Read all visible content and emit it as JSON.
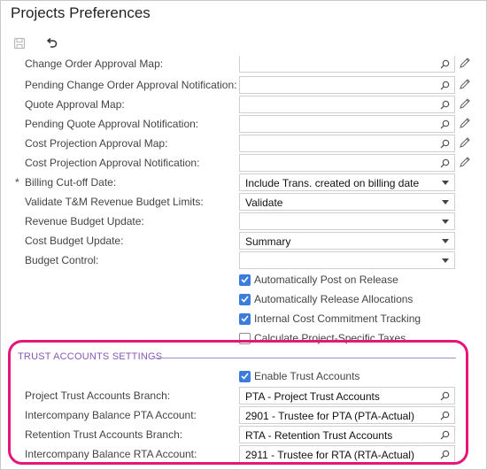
{
  "title": "Projects Preferences",
  "toolbar": {
    "save_icon": "save-icon",
    "undo_icon": "undo-icon"
  },
  "rows": {
    "change_order_map": {
      "label": "Change Order Approval Map:"
    },
    "pending_co_notification": {
      "label": "Pending Change Order Approval Notification:"
    },
    "quote_map": {
      "label": "Quote Approval Map:"
    },
    "pending_quote_notification": {
      "label": "Pending Quote Approval Notification:"
    },
    "cost_projection_map": {
      "label": "Cost Projection Approval Map:"
    },
    "cost_projection_notification": {
      "label": "Cost Projection Approval Notification:"
    },
    "billing_cutoff": {
      "required": "*",
      "label": "Billing Cut-off Date:",
      "value": "Include Trans. created on billing date"
    },
    "validate_tm": {
      "label": "Validate T&M Revenue Budget Limits:",
      "value": "Validate"
    },
    "revenue_budget_update": {
      "label": "Revenue Budget Update:",
      "value": ""
    },
    "cost_budget_update": {
      "label": "Cost Budget Update:",
      "value": "Summary"
    },
    "budget_control": {
      "label": "Budget Control:",
      "value": ""
    }
  },
  "checkboxes": {
    "auto_post": {
      "label": "Automatically Post on Release",
      "checked": true
    },
    "auto_release": {
      "label": "Automatically Release Allocations",
      "checked": true
    },
    "internal_cost": {
      "label": "Internal Cost Commitment Tracking",
      "checked": true
    },
    "calc_taxes": {
      "label": "Calculate Project-Specific Taxes",
      "checked": false
    }
  },
  "trust": {
    "header": "TRUST ACCOUNTS SETTINGS",
    "enable": {
      "label": "Enable Trust Accounts",
      "checked": true
    },
    "pta_branch": {
      "label": "Project Trust Accounts Branch:",
      "value": "PTA - Project Trust Accounts"
    },
    "ic_pta_account": {
      "label": "Intercompany Balance PTA Account:",
      "value": "2901 - Trustee for PTA (PTA-Actual)"
    },
    "rta_branch": {
      "label": "Retention Trust Accounts Branch:",
      "value": "RTA - Retention Trust Accounts"
    },
    "ic_rta_account": {
      "label": "Intercompany Balance RTA Account:",
      "value": "2911 - Trustee for RTA (RTA-Actual)"
    }
  },
  "colors": {
    "accent": "#3b7ddd",
    "section": "#8a57b5",
    "highlight": "#e5157a"
  }
}
